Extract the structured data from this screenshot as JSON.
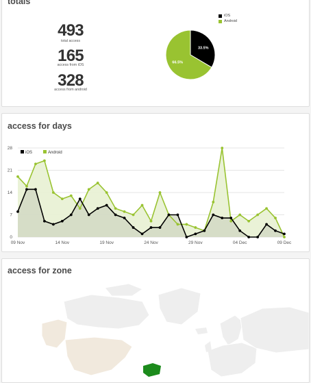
{
  "totals": {
    "title": "totals",
    "stats": [
      {
        "value": "493",
        "label": "total access"
      },
      {
        "value": "165",
        "label": "access from iOS"
      },
      {
        "value": "328",
        "label": "access from android"
      }
    ]
  },
  "days": {
    "title": "access for days"
  },
  "zone": {
    "title": "access for zone"
  },
  "colors": {
    "ios": "#000000",
    "android": "#99c331",
    "ios_fill": "#cfd6c1",
    "android_fill": "#e8f1d3",
    "map_land": "#eeeeee",
    "map_highlight": "#f1e9dd",
    "map_spain": "#1c8b1c"
  },
  "chart_data": [
    {
      "type": "pie",
      "series": [
        {
          "name": "iOS",
          "value": 33.5,
          "label": "33.5%"
        },
        {
          "name": "Android",
          "value": 66.5,
          "label": "66.5%"
        }
      ],
      "legend": "top-right"
    },
    {
      "type": "area",
      "x": [
        "09 Nov",
        "10 Nov",
        "11 Nov",
        "12 Nov",
        "13 Nov",
        "14 Nov",
        "15 Nov",
        "16 Nov",
        "17 Nov",
        "18 Nov",
        "19 Nov",
        "20 Nov",
        "21 Nov",
        "22 Nov",
        "23 Nov",
        "24 Nov",
        "25 Nov",
        "26 Nov",
        "27 Nov",
        "28 Nov",
        "29 Nov",
        "30 Nov",
        "01 Dec",
        "02 Dec",
        "03 Dec",
        "04 Dec",
        "05 Dec",
        "06 Dec",
        "07 Dec",
        "08 Dec",
        "09 Dec"
      ],
      "x_ticks": [
        "09 Nov",
        "14 Nov",
        "19 Nov",
        "24 Nov",
        "29 Nov",
        "04 Dec",
        "09 Dec"
      ],
      "y_ticks": [
        0,
        7,
        14,
        21,
        28
      ],
      "ylim": [
        0,
        28
      ],
      "series": [
        {
          "name": "iOS",
          "values": [
            8,
            15,
            15,
            5,
            4,
            5,
            7,
            12,
            7,
            9,
            10,
            7,
            6,
            3,
            1,
            3,
            3,
            7,
            7,
            0,
            1,
            2,
            7,
            6,
            6,
            2,
            0,
            0,
            4,
            2,
            1
          ]
        },
        {
          "name": "Android",
          "values": [
            19,
            16,
            23,
            24,
            14,
            12,
            13,
            9,
            15,
            17,
            14,
            9,
            8,
            7,
            10,
            5,
            14,
            7,
            4,
            4,
            3,
            2,
            11,
            28,
            5,
            7,
            5,
            7,
            9,
            6,
            0
          ]
        }
      ],
      "legend": "top-left",
      "grid": true
    }
  ]
}
